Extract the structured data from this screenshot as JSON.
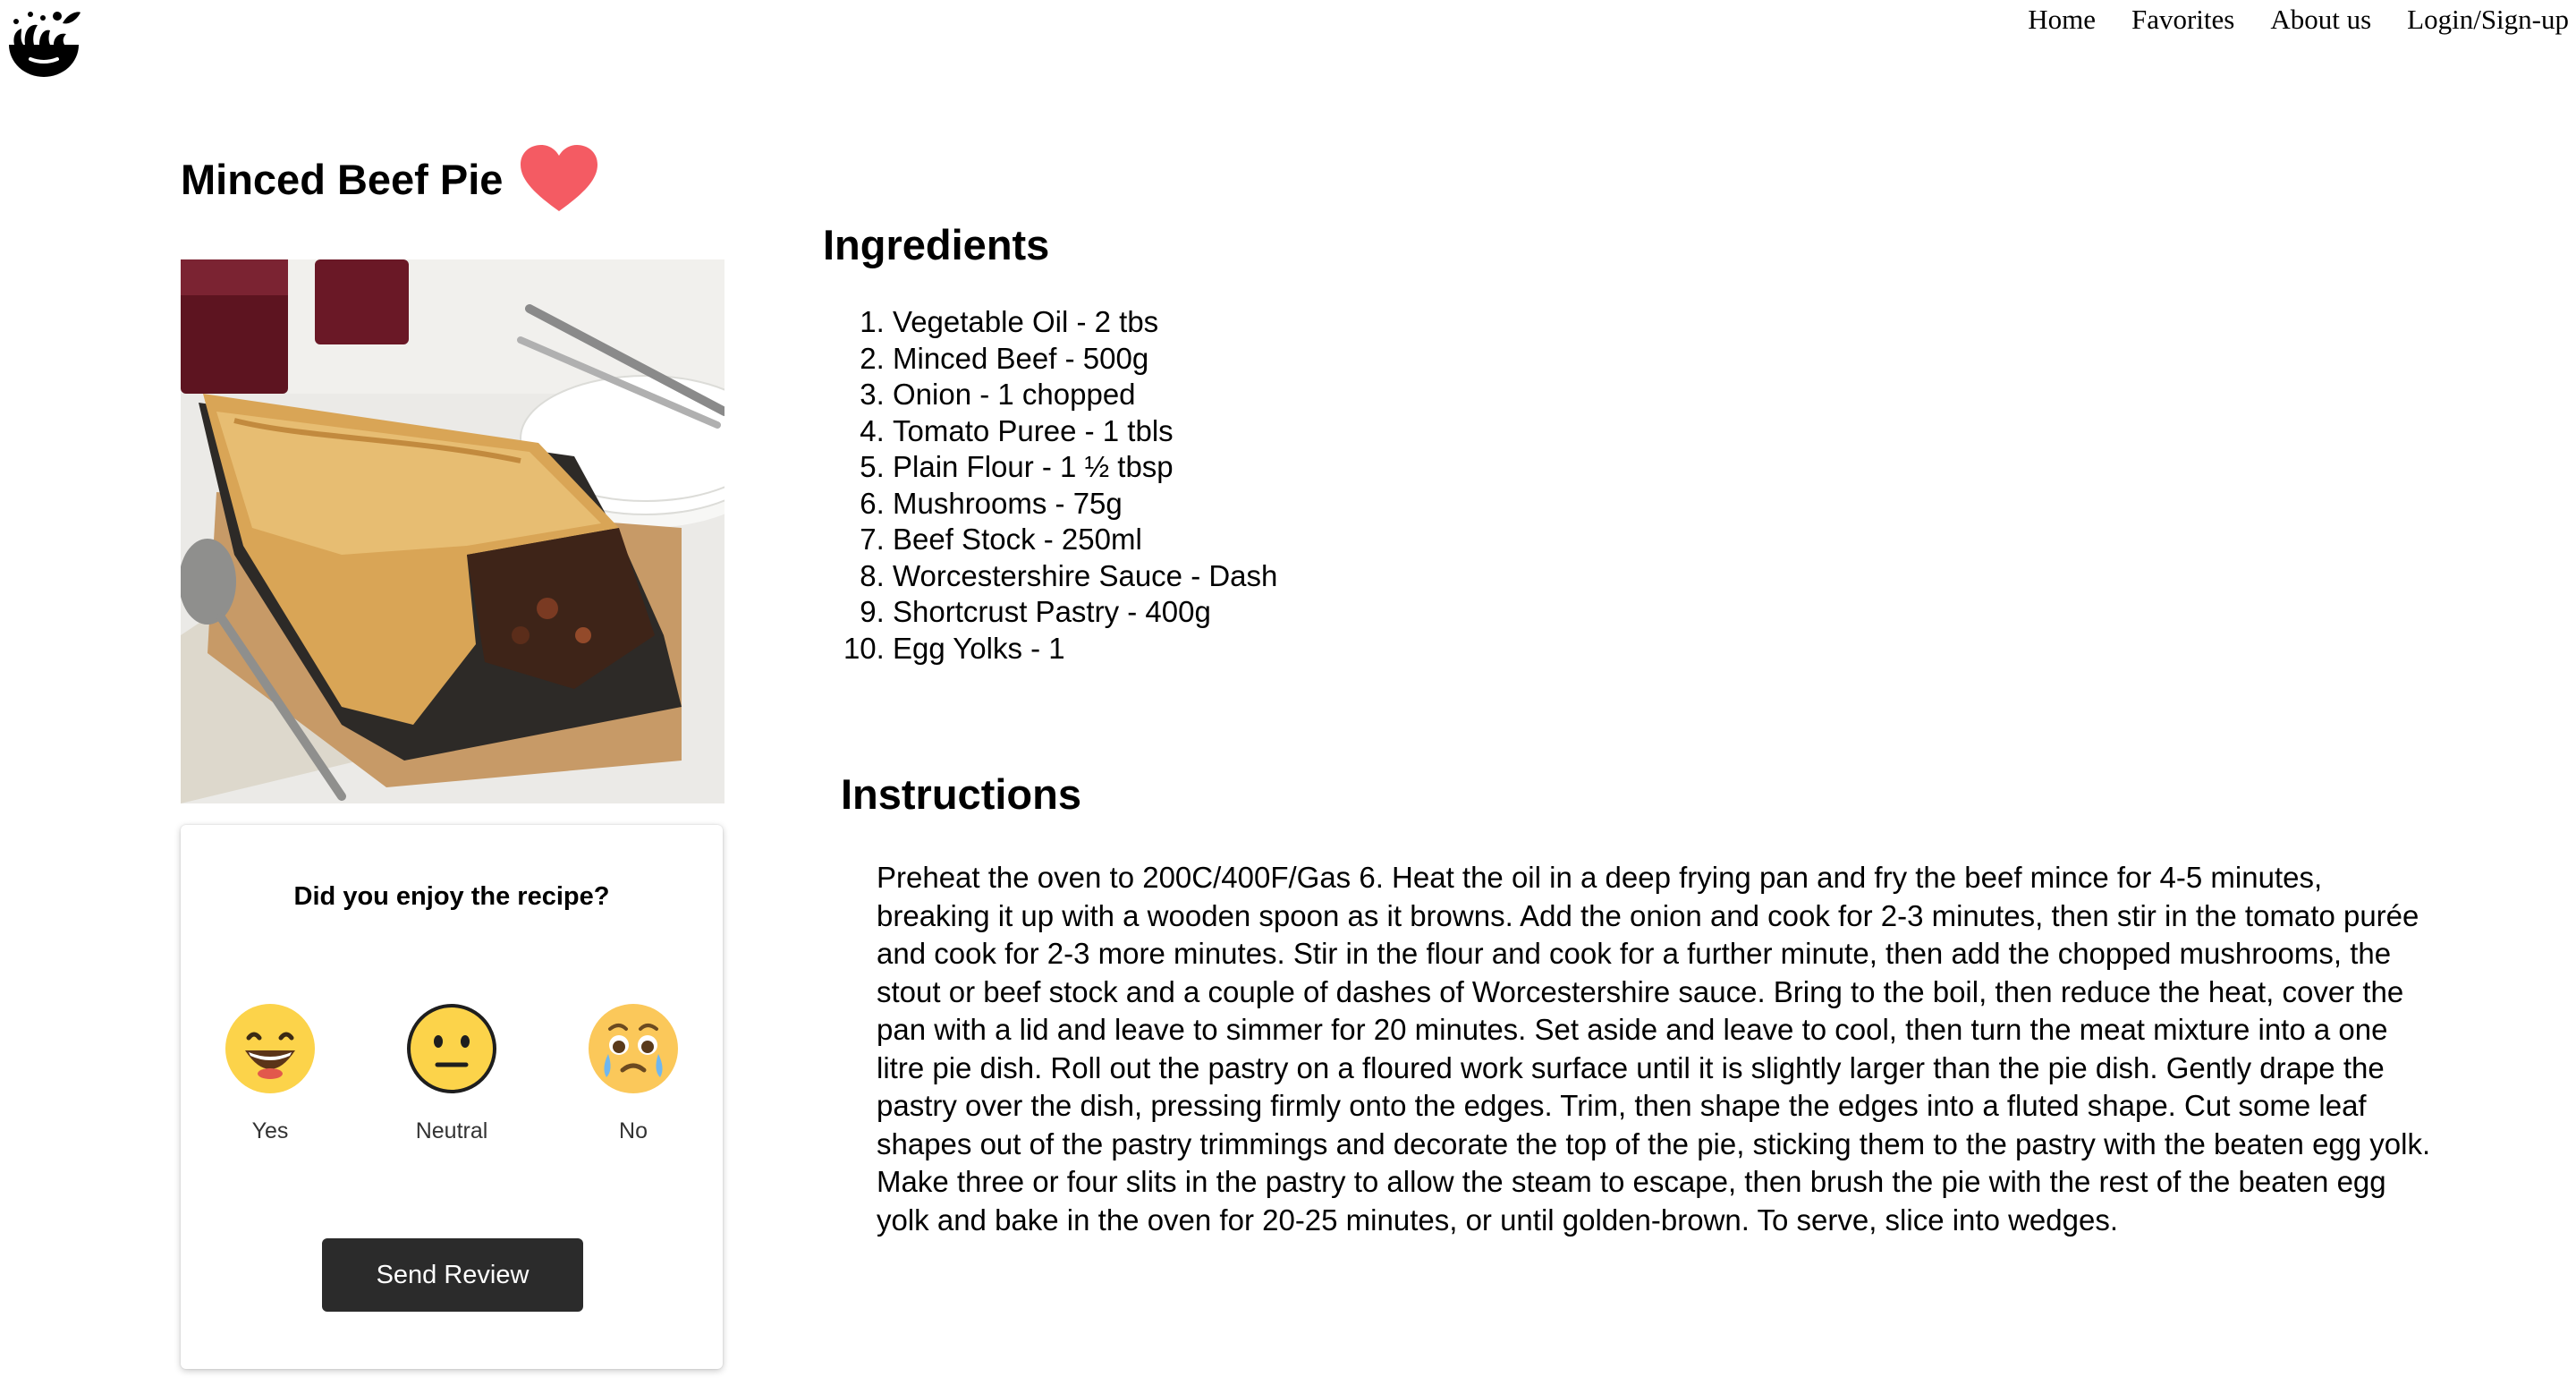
{
  "nav": {
    "items": [
      {
        "label": "Home"
      },
      {
        "label": "Favorites"
      },
      {
        "label": "About us"
      },
      {
        "label": "Login/Sign-up"
      }
    ]
  },
  "recipe": {
    "title": "Minced Beef Pie",
    "favorite_icon": "heart-icon",
    "favorite_color": "#f45b63"
  },
  "review": {
    "question": "Did you enjoy the recipe?",
    "options": [
      {
        "label": "Yes",
        "icon": "grinning-face-icon"
      },
      {
        "label": "Neutral",
        "icon": "neutral-face-icon"
      },
      {
        "label": "No",
        "icon": "crying-face-icon"
      }
    ],
    "submit_label": "Send Review"
  },
  "ingredients": {
    "heading": "Ingredients",
    "items": [
      "Vegetable Oil - 2 tbs",
      "Minced Beef - 500g",
      "Onion - 1 chopped",
      "Tomato Puree - 1 tbls",
      "Plain Flour - 1 ½ tbsp",
      "Mushrooms - 75g",
      "Beef Stock - 250ml",
      "Worcestershire Sauce - Dash",
      "Shortcrust Pastry - 400g",
      "Egg Yolks - 1"
    ]
  },
  "instructions": {
    "heading": "Instructions",
    "text": "Preheat the oven to 200C/400F/Gas 6. Heat the oil in a deep frying pan and fry the beef mince for 4-5 minutes, breaking it up with a wooden spoon as it browns. Add the onion and cook for 2-3 minutes, then stir in the tomato purée and cook for 2-3 more minutes. Stir in the flour and cook for a further minute, then add the chopped mushrooms, the stout or beef stock and a couple of dashes of Worcestershire sauce. Bring to the boil, then reduce the heat, cover the pan with a lid and leave to simmer for 20 minutes. Set aside and leave to cool, then turn the meat mixture into a one litre pie dish. Roll out the pastry on a floured work surface until it is slightly larger than the pie dish. Gently drape the pastry over the dish, pressing firmly onto the edges. Trim, then shape the edges into a fluted shape. Cut some leaf shapes out of the pastry trimmings and decorate the top of the pie, sticking them to the pastry with the beaten egg yolk. Make three or four slits in the pastry to allow the steam to escape, then brush the pie with the rest of the beaten egg yolk and bake in the oven for 20-25 minutes, or until golden-brown. To serve, slice into wedges."
  }
}
